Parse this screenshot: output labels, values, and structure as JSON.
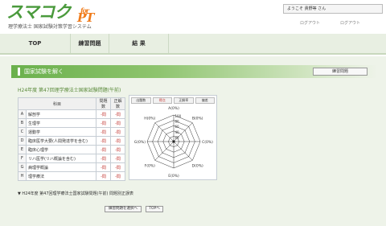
{
  "header": {
    "logo_main": "スマコク",
    "logo_for": "for",
    "logo_pt": "PT",
    "subtitle": "理学療法士 国家試験対策学習システム",
    "welcome": "ようこそ 貴野等 さん",
    "logout1": "ログアウト",
    "logout2": "ログアウト"
  },
  "nav": {
    "tabs": [
      "TOP",
      "練習問題",
      "結 果"
    ]
  },
  "banner": {
    "title": "国家試験を解く",
    "button": "練習問題"
  },
  "section": {
    "title": "H24年度 第47回理学療法士国家試験問題(午前)"
  },
  "table": {
    "headers": [
      "科目",
      "問題数",
      "正解数"
    ],
    "rows": [
      {
        "letter": "A",
        "subject": "解剖学",
        "q": "-問",
        "c": "-問"
      },
      {
        "letter": "B",
        "subject": "生理学",
        "q": "-問",
        "c": "-問"
      },
      {
        "letter": "C",
        "subject": "運動学",
        "q": "-問",
        "c": "-問"
      },
      {
        "letter": "D",
        "subject": "臨床医学大要(人間発達学を含む)",
        "q": "-問",
        "c": "-問"
      },
      {
        "letter": "E",
        "subject": "臨床心理学",
        "q": "-問",
        "c": "-問"
      },
      {
        "letter": "F",
        "subject": "リハ医学(リハ概論を含む)",
        "q": "-問",
        "c": "-問"
      },
      {
        "letter": "G",
        "subject": "病理学概論",
        "q": "-問",
        "c": "-問"
      },
      {
        "letter": "H",
        "subject": "理学療法",
        "q": "-問",
        "c": "-問"
      }
    ]
  },
  "radar": {
    "tabs": [
      "出題数",
      "得点",
      "正解率",
      "偏差"
    ],
    "scale_labels": [
      "100",
      "80",
      "60",
      "40",
      "20"
    ],
    "axis_labels": [
      "A(0%)",
      "B(0%)",
      "C(0%)",
      "D(0%)",
      "E(0%)",
      "F(0%)",
      "G(0%)",
      "H(0%)"
    ]
  },
  "footer": {
    "line": "▼ H24年度 第47回理学療法士国家試験問題(午前) 問題別正誤表",
    "btn_select": "練習問題を選択へ",
    "btn_top": "TOPへ"
  },
  "colors": {
    "brand_green": "#4a9a3c",
    "accent_orange": "#f07c1c",
    "count_red": "#c0302b"
  }
}
